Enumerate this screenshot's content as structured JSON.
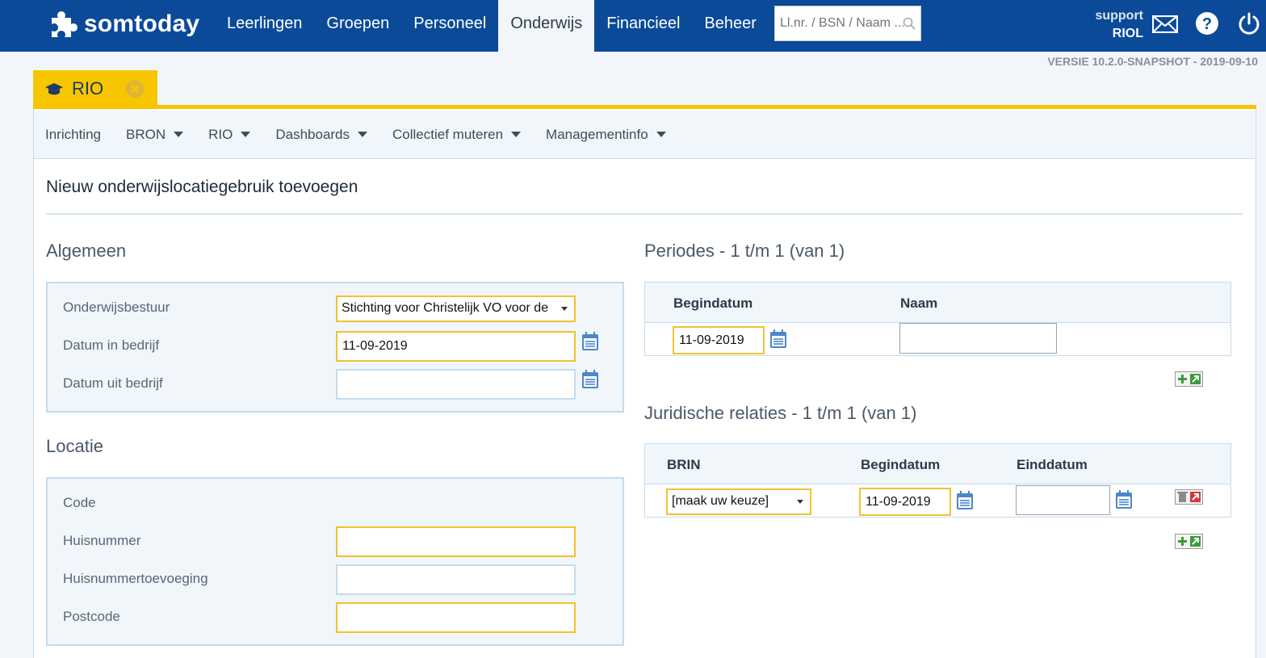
{
  "header": {
    "brand": "somtoday",
    "nav": [
      {
        "label": "Leerlingen"
      },
      {
        "label": "Groepen"
      },
      {
        "label": "Personeel"
      },
      {
        "label": "Onderwijs",
        "active": true
      },
      {
        "label": "Financieel"
      },
      {
        "label": "Beheer"
      }
    ],
    "search_placeholder": "Ll.nr. / BSN / Naam ...",
    "user_line1": "support",
    "user_line2": "RIOL",
    "icons": [
      "mail-icon",
      "help-icon",
      "power-icon"
    ],
    "brand_color": "#0a4a99"
  },
  "version": "VERSIE 10.2.0-SNAPSHOT - 2019-09-10",
  "tab": {
    "label": "RIO",
    "icon": "graduation-cap-icon",
    "accent": "#f7c600"
  },
  "subnav": [
    {
      "label": "Inrichting",
      "dropdown": false
    },
    {
      "label": "BRON",
      "dropdown": true
    },
    {
      "label": "RIO",
      "dropdown": true
    },
    {
      "label": "Dashboards",
      "dropdown": true
    },
    {
      "label": "Collectief muteren",
      "dropdown": true
    },
    {
      "label": "Managementinfo",
      "dropdown": true
    }
  ],
  "page_title": "Nieuw onderwijslocatiegebruik toevoegen",
  "algemeen": {
    "heading": "Algemeen",
    "onderwijsbestuur_label": "Onderwijsbestuur",
    "onderwijsbestuur_value": "Stichting voor Christelijk VO voor de",
    "datum_in_label": "Datum in bedrijf",
    "datum_in_value": "11-09-2019",
    "datum_uit_label": "Datum uit bedrijf",
    "datum_uit_value": ""
  },
  "locatie": {
    "heading": "Locatie",
    "code_label": "Code",
    "huisnummer_label": "Huisnummer",
    "huisnummer_value": "",
    "toevoeging_label": "Huisnummertoevoeging",
    "toevoeging_value": "",
    "postcode_label": "Postcode",
    "postcode_value": ""
  },
  "periodes": {
    "heading": "Periodes - 1 t/m 1 (van 1)",
    "col_begindatum": "Begindatum",
    "col_naam": "Naam",
    "row_begindatum": "11-09-2019",
    "row_naam": ""
  },
  "juridisch": {
    "heading": "Juridische relaties - 1 t/m 1 (van 1)",
    "col_brin": "BRIN",
    "col_begindatum": "Begindatum",
    "col_einddatum": "Einddatum",
    "row_brin": "[maak uw keuze]",
    "row_begindatum": "11-09-2019",
    "row_einddatum": ""
  }
}
